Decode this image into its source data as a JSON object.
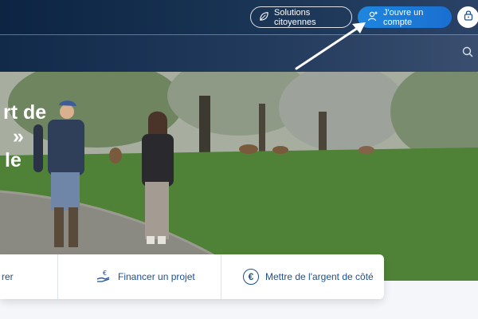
{
  "header": {
    "solutions_label": "Solutions citoyennes",
    "account_label": "J'ouvre un compte",
    "icons": {
      "solutions": "leaf-icon",
      "account": "add-user-icon",
      "lock": "lock-icon",
      "search": "search-icon"
    }
  },
  "hero": {
    "title_lines": [
      "rt de",
      "»",
      "le"
    ]
  },
  "quick_links": [
    {
      "label": "rer",
      "icon": ""
    },
    {
      "label": "Financer un projet",
      "icon": "hand-coin-icon"
    },
    {
      "label": "Mettre de l'argent de côté",
      "icon": "euro-icon"
    }
  ],
  "colors": {
    "header_bg": "#0d2443",
    "accent": "#1f86de",
    "link": "#1d4f91"
  }
}
